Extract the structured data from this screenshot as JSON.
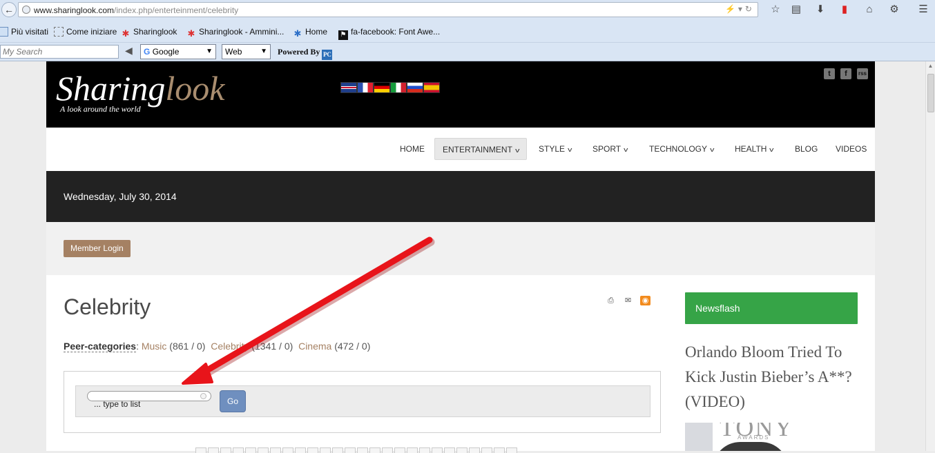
{
  "browser": {
    "url_domain": "www.sharinglook.com",
    "url_path": "/index.php/enterteinment/celebrity",
    "bookmarks": [
      "Più visitati",
      "Come iniziare",
      "Sharinglook",
      "Sharinglook - Ammini...",
      "Home",
      "fa-facebook: Font Awe..."
    ],
    "search_placeholder": "My Search",
    "engine_select": "Google",
    "scope_select": "Web",
    "powered_by": "Powered By",
    "powered_logo": "PC"
  },
  "site": {
    "logo_main": "Sharing",
    "logo_accent": "look",
    "logo_tagline": "A look around the world",
    "flags": [
      {
        "name": "flag-uk-icon",
        "color": "#1f3e8a"
      },
      {
        "name": "flag-france-icon",
        "color": "#2a4fb0"
      },
      {
        "name": "flag-germany-icon",
        "color": "#000000"
      },
      {
        "name": "flag-italy-icon",
        "color": "#169b3b"
      },
      {
        "name": "flag-russia-icon",
        "color": "#ffffff"
      },
      {
        "name": "flag-spain-icon",
        "color": "#c8102e"
      }
    ],
    "social": [
      "t",
      "f",
      "rss"
    ],
    "nav": [
      {
        "label": "HOME",
        "dropdown": false,
        "active": false
      },
      {
        "label": "ENTERTAINMENT",
        "dropdown": true,
        "active": true
      },
      {
        "label": "STYLE",
        "dropdown": true,
        "active": false
      },
      {
        "label": "SPORT",
        "dropdown": true,
        "active": false
      },
      {
        "label": "TECHNOLOGY",
        "dropdown": true,
        "active": false
      },
      {
        "label": "HEALTH",
        "dropdown": true,
        "active": false
      },
      {
        "label": "BLOG",
        "dropdown": false,
        "active": false
      },
      {
        "label": "VIDEOS",
        "dropdown": false,
        "active": false
      }
    ],
    "date": "Wednesday, July 30, 2014",
    "member_login": "Member Login"
  },
  "content": {
    "title": "Celebrity",
    "peer_label": "Peer-categories",
    "peer_colon": ":",
    "peers": [
      {
        "name": "Music",
        "count": "(861 / 0)"
      },
      {
        "name": "Celebrity",
        "count": "(1341 / 0)"
      },
      {
        "name": "Cinema",
        "count": "(472 / 0)"
      }
    ],
    "filter_hint": "... type to list",
    "go_label": "Go"
  },
  "sidebar": {
    "newsflash": "Newsflash",
    "headline": "Orlando Bloom Tried To Kick Justin Bieber’s A**? (VIDEO)",
    "image_text": "TONY",
    "image_subtext": "AWARDS"
  },
  "colors": {
    "accent": "#a58163",
    "newsflash_green": "#36a447",
    "arrow_red": "#e8141a"
  }
}
